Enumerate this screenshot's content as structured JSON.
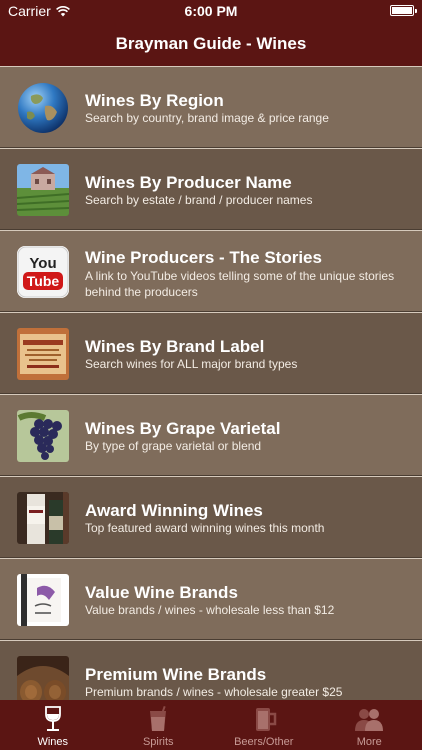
{
  "status": {
    "carrier": "Carrier",
    "time": "6:00 PM"
  },
  "nav": {
    "title": "Brayman Guide - Wines"
  },
  "rows": [
    {
      "title": "Wines By Region",
      "subtitle": "Search by country, brand image & price range",
      "icon": "globe-icon"
    },
    {
      "title": "Wines By Producer Name",
      "subtitle": "Search by estate / brand / producer names",
      "icon": "estate-photo-icon"
    },
    {
      "title": "Wine Producers - The Stories",
      "subtitle": "A link to YouTube videos telling some of the unique stories behind the producers",
      "icon": "youtube-icon"
    },
    {
      "title": "Wines By Brand Label",
      "subtitle": "Search wines for ALL major brand types",
      "icon": "wine-label-icon"
    },
    {
      "title": "Wines By Grape Varietal",
      "subtitle": "By type of grape varietal or blend",
      "icon": "grapes-icon"
    },
    {
      "title": "Award Winning Wines",
      "subtitle": "Top featured award winning wines this month",
      "icon": "award-bottle-icon"
    },
    {
      "title": "Value Wine Brands",
      "subtitle": "Value brands / wines - wholesale less than $12",
      "icon": "value-bottle-icon"
    },
    {
      "title": "Premium Wine Brands",
      "subtitle": "Premium brands / wines - wholesale greater $25",
      "icon": "cellar-barrels-icon"
    }
  ],
  "thumb_text": {
    "youtube_you": "You",
    "youtube_tube": "Tube"
  },
  "tabs": [
    {
      "label": "Wines",
      "icon": "wine-glass-icon",
      "active": true
    },
    {
      "label": "Spirits",
      "icon": "cocktail-glass-icon",
      "active": false
    },
    {
      "label": "Beers/Other",
      "icon": "beer-mug-icon",
      "active": false
    },
    {
      "label": "More",
      "icon": "people-icon",
      "active": false
    }
  ],
  "colors": {
    "header": "#5b1513",
    "row_light": "#7f6c5b",
    "row_dark": "#6a5849",
    "tab_inactive": "#c79a95"
  }
}
